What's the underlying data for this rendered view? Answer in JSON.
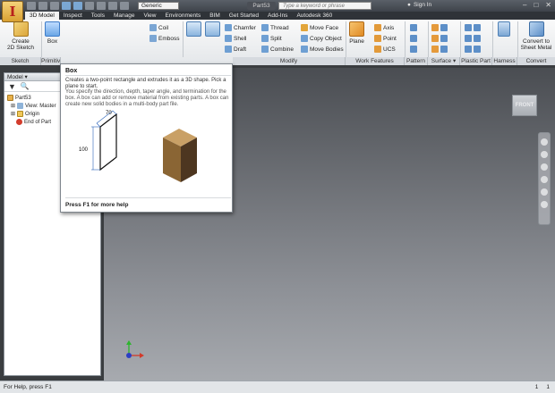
{
  "titlebar": {
    "app_letter": "I",
    "style_value": "Generic",
    "doc_title": "Part53",
    "search_placeholder": "Type a keyword or phrase",
    "sign_in": "Sign In"
  },
  "tabs": [
    "3D Model",
    "Inspect",
    "Tools",
    "Manage",
    "View",
    "Environments",
    "BIM",
    "Get Started",
    "Add-Ins",
    "Autodesk 360"
  ],
  "ribbon": {
    "sketch": {
      "create_line1": "Create",
      "create_line2": "2D Sketch",
      "panel": "Sketch"
    },
    "primitives": {
      "box": "Box",
      "panel": "Primitives"
    },
    "create": {
      "loft": "Loft",
      "sweep": "Sweep",
      "coil": "Coil",
      "emboss": "Emboss"
    },
    "modify": {
      "chamfer": "Chamfer",
      "shell": "Shell",
      "draft": "Draft",
      "thread": "Thread",
      "split": "Split",
      "combine": "Combine",
      "move_face": "Move Face",
      "copy_object": "Copy Object",
      "move_bodies": "Move Bodies",
      "panel": "Modify"
    },
    "work_features": {
      "plane": "Plane",
      "axis": "Axis",
      "point": "Point",
      "ucs": "UCS",
      "panel": "Work Features"
    },
    "pattern": {
      "panel": "Pattern"
    },
    "surface": {
      "panel": "Surface"
    },
    "plastic": {
      "panel": "Plastic Part"
    },
    "harness": {
      "panel": "Harness"
    },
    "convert": {
      "label_line1": "Convert to",
      "label_line2": "Sheet Metal",
      "panel": "Convert"
    }
  },
  "browser": {
    "title": "Model",
    "tree": [
      {
        "label": "Part53",
        "icon": "part-icon"
      },
      {
        "label": "View: Master",
        "icon": "view-icon"
      },
      {
        "label": "Origin",
        "icon": "folder-icon"
      },
      {
        "label": "End of Part",
        "icon": "end-of-part-icon"
      }
    ]
  },
  "tooltip": {
    "title": "Box",
    "short": "Creates a two-point rectangle and extrudes it as a 3D shape. Pick a plane to start.",
    "long": "You specify the direction, depth, taper angle, and termination for the box. A box can add or remove material from existing parts. A box can create new solid bodies in a multi-body part file.",
    "dim_width": "70",
    "dim_height": "100",
    "footer": "Press F1 for more help"
  },
  "viewcube": {
    "face": "FRONT"
  },
  "status": {
    "left": "For Help, press F1",
    "right_a": "1",
    "right_b": "1"
  },
  "colors": {
    "accent": "#3d7cc9",
    "ribbon_bg": "#eef0f2",
    "viewport_top": "#4a4d52",
    "viewport_bottom": "#a7aaaf"
  }
}
